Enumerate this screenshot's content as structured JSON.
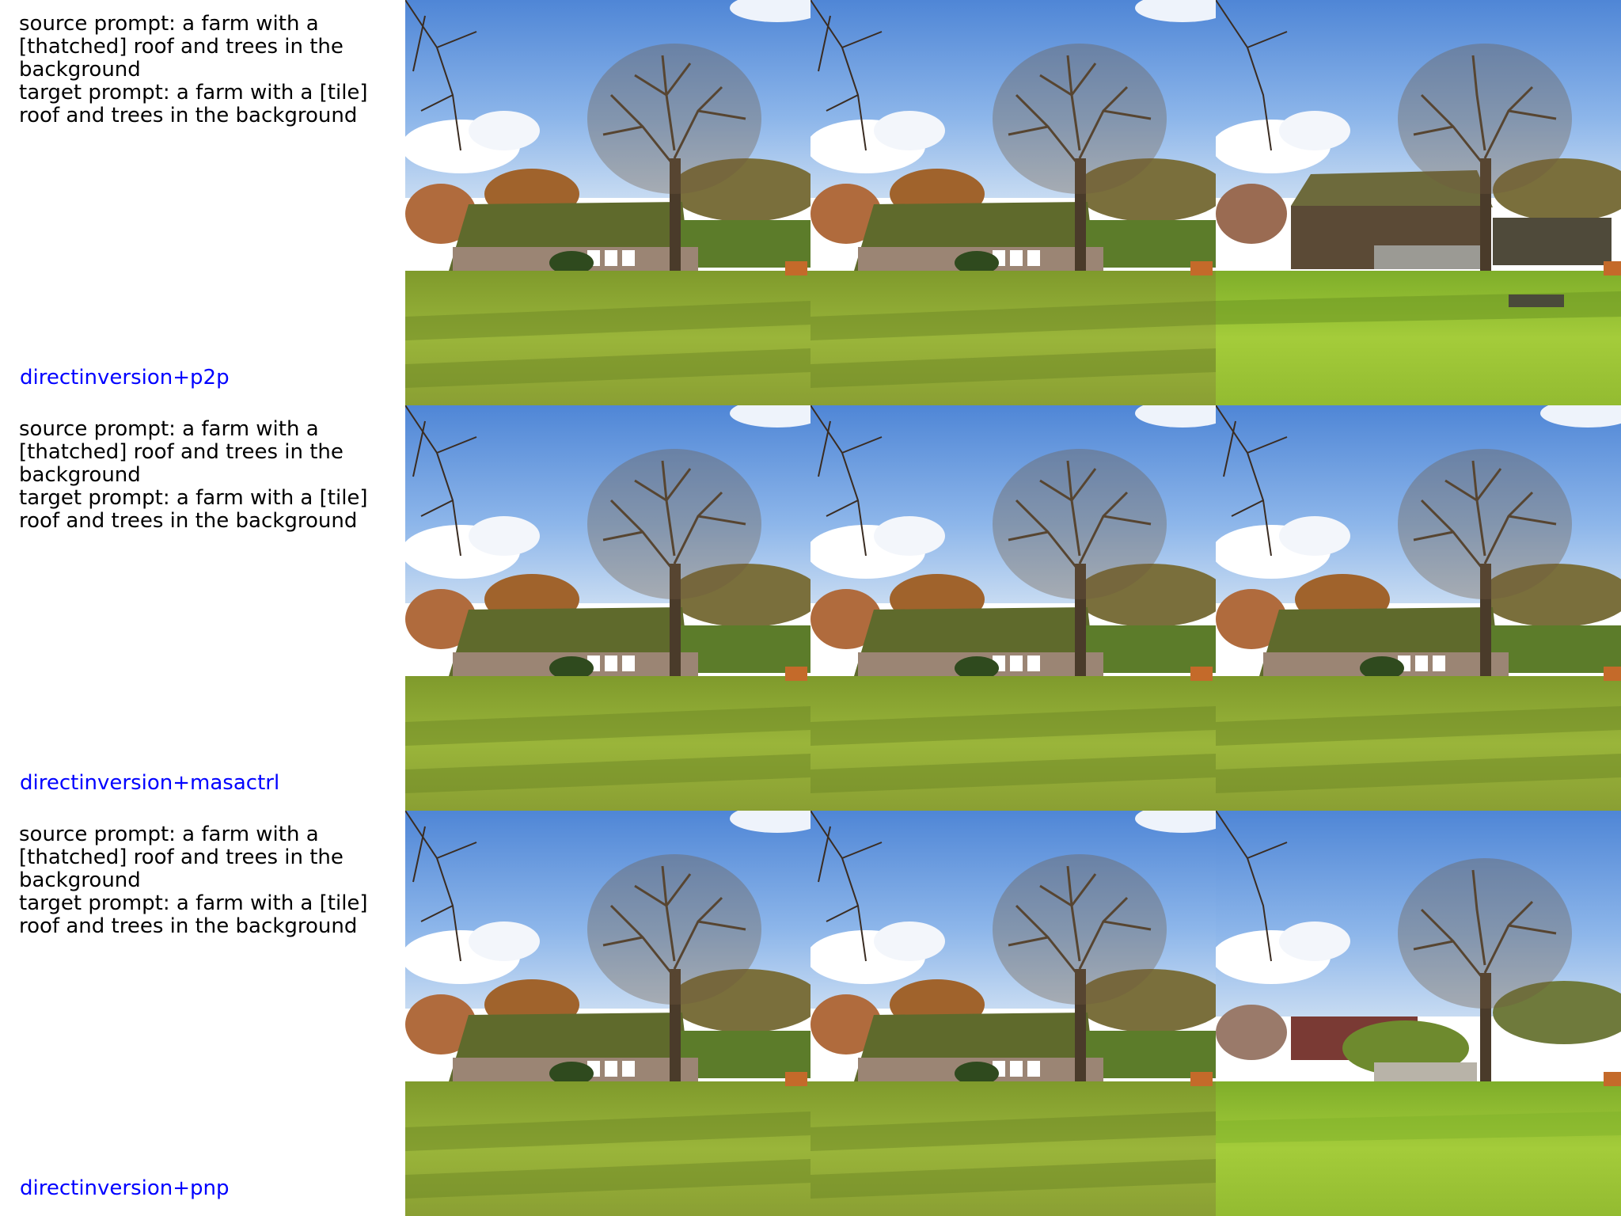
{
  "rows": [
    {
      "source_prompt": "source prompt: a farm with a [thatched] roof and trees in the background",
      "target_prompt": "target prompt: a farm with a [tile] roof and trees in the background",
      "method": "directinversion+p2p"
    },
    {
      "source_prompt": "source prompt: a farm with a [thatched] roof and trees in the background",
      "target_prompt": "target prompt: a farm with a [tile] roof and trees in the background",
      "method": "directinversion+masactrl"
    },
    {
      "source_prompt": "source prompt: a farm with a [thatched] roof and trees in the background",
      "target_prompt": "target prompt: a farm with a [tile] roof and trees in the background",
      "method": "directinversion+pnp"
    }
  ],
  "colors": {
    "method_label": "#0000ff",
    "prompt_text": "#000000",
    "sky": "#6d9be0",
    "grass": "#8fae2e",
    "roof": "#5f6a2c"
  }
}
